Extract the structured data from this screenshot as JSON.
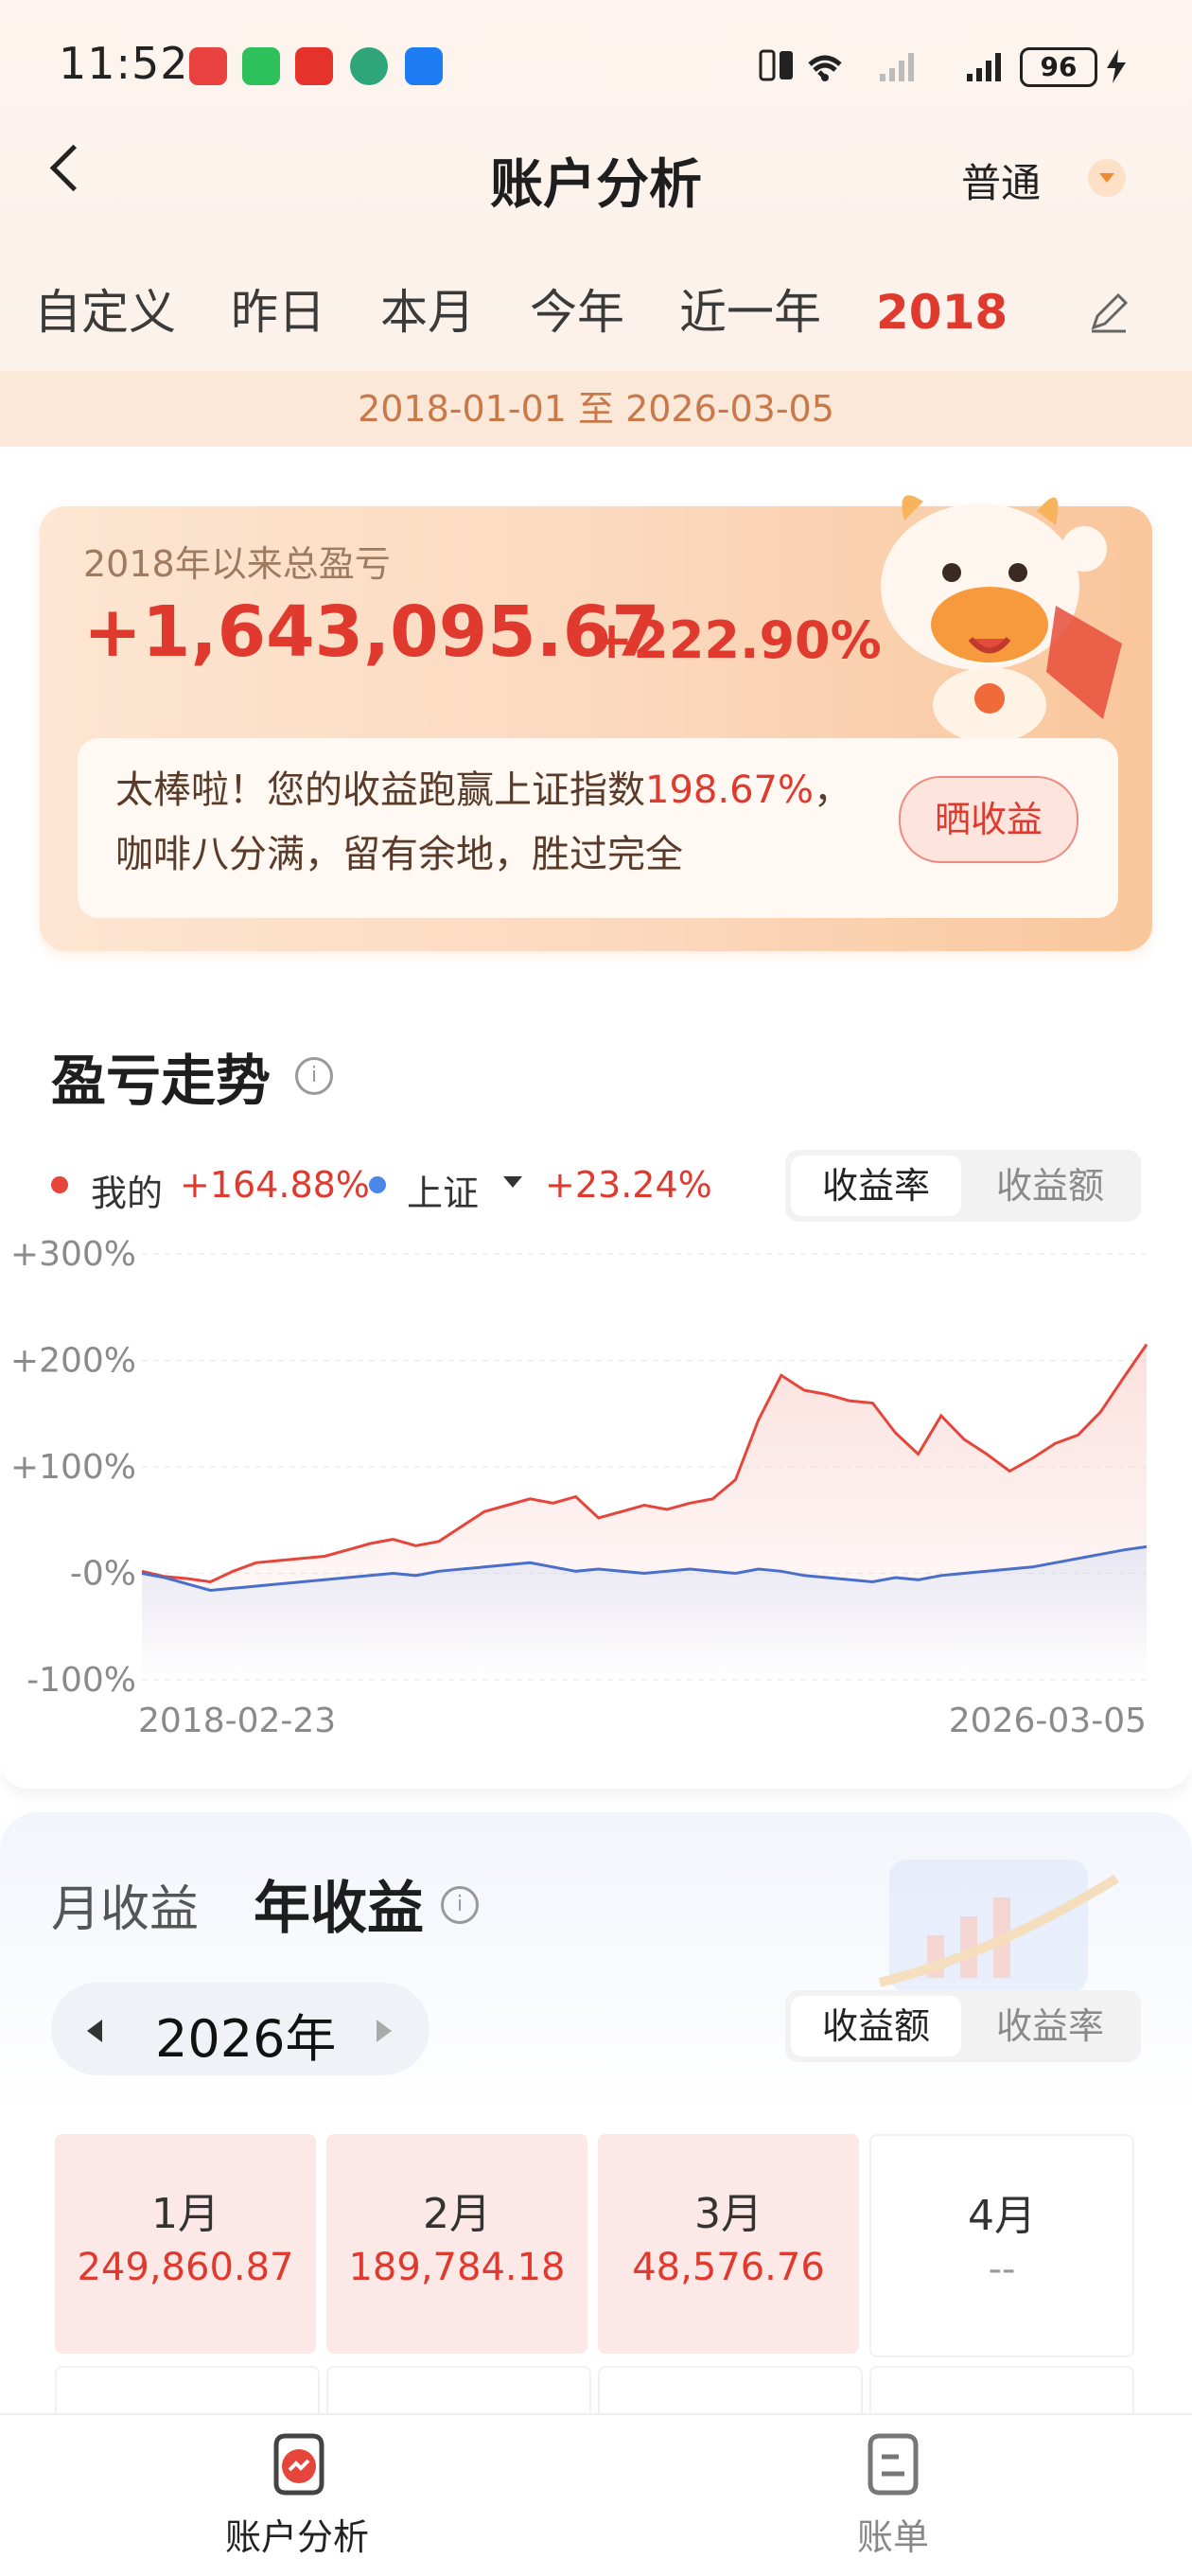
{
  "status_bar": {
    "time": "11:52",
    "battery": "96"
  },
  "header": {
    "title": "账户分析",
    "mode": "普通"
  },
  "tabs": [
    "自定义",
    "昨日",
    "本月",
    "今年",
    "近一年",
    "2018"
  ],
  "active_tab_index": 5,
  "date_range": "2018-01-01 至 2026-03-05",
  "summary": {
    "label": "2018年以来总盈亏",
    "amount": "+1,643,095.67",
    "percent": "+222.90%",
    "message_prefix": "太棒啦！您的收益跑赢上证指数",
    "message_pct": "198.67%",
    "message_suffix": "，",
    "message_line2": "咖啡八分满，留有余地，胜过完全",
    "share_label": "晒收益"
  },
  "trend": {
    "title": "盈亏走势",
    "mine_label": "我的",
    "mine_value": "+164.88%",
    "index_label": "上证",
    "index_value": "+23.24%",
    "toggle_on": "收益率",
    "toggle_off": "收益额"
  },
  "chart_data": {
    "type": "line",
    "x_start": "2018-02-23",
    "x_end": "2026-03-05",
    "y_ticks": [
      "+300%",
      "+200%",
      "+100%",
      "-0%",
      "-100%"
    ],
    "ylim": [
      -100,
      300
    ],
    "series": [
      {
        "name": "我的",
        "color": "#e5453b",
        "values": [
          2,
          -3,
          -5,
          -8,
          2,
          10,
          12,
          14,
          16,
          22,
          28,
          32,
          26,
          30,
          44,
          58,
          64,
          70,
          66,
          72,
          52,
          58,
          64,
          60,
          66,
          70,
          88,
          144,
          186,
          172,
          168,
          162,
          160,
          132,
          112,
          148,
          126,
          112,
          96,
          108,
          122,
          130,
          152,
          184,
          215
        ]
      },
      {
        "name": "上证",
        "color": "#4a6fca",
        "values": [
          0,
          -4,
          -10,
          -16,
          -14,
          -12,
          -10,
          -8,
          -6,
          -4,
          -2,
          0,
          -2,
          2,
          4,
          6,
          8,
          10,
          6,
          2,
          4,
          2,
          0,
          2,
          4,
          2,
          0,
          4,
          2,
          -2,
          -4,
          -6,
          -8,
          -4,
          -6,
          -2,
          0,
          2,
          4,
          6,
          10,
          14,
          18,
          22,
          25
        ]
      }
    ]
  },
  "yearly": {
    "tab_month": "月收益",
    "tab_year": "年收益",
    "year": "2026年",
    "toggle_on": "收益额",
    "toggle_off": "收益率",
    "months": [
      {
        "label": "1月",
        "value": "249,860.87"
      },
      {
        "label": "2月",
        "value": "189,784.18"
      },
      {
        "label": "3月",
        "value": "48,576.76"
      },
      {
        "label": "4月",
        "value": "--"
      }
    ]
  },
  "bottom_nav": {
    "analysis": "账户分析",
    "bill": "账单"
  },
  "colors": {
    "accent_red": "#e03a2f",
    "index_blue": "#4a6fca",
    "orange": "#f08b34"
  }
}
